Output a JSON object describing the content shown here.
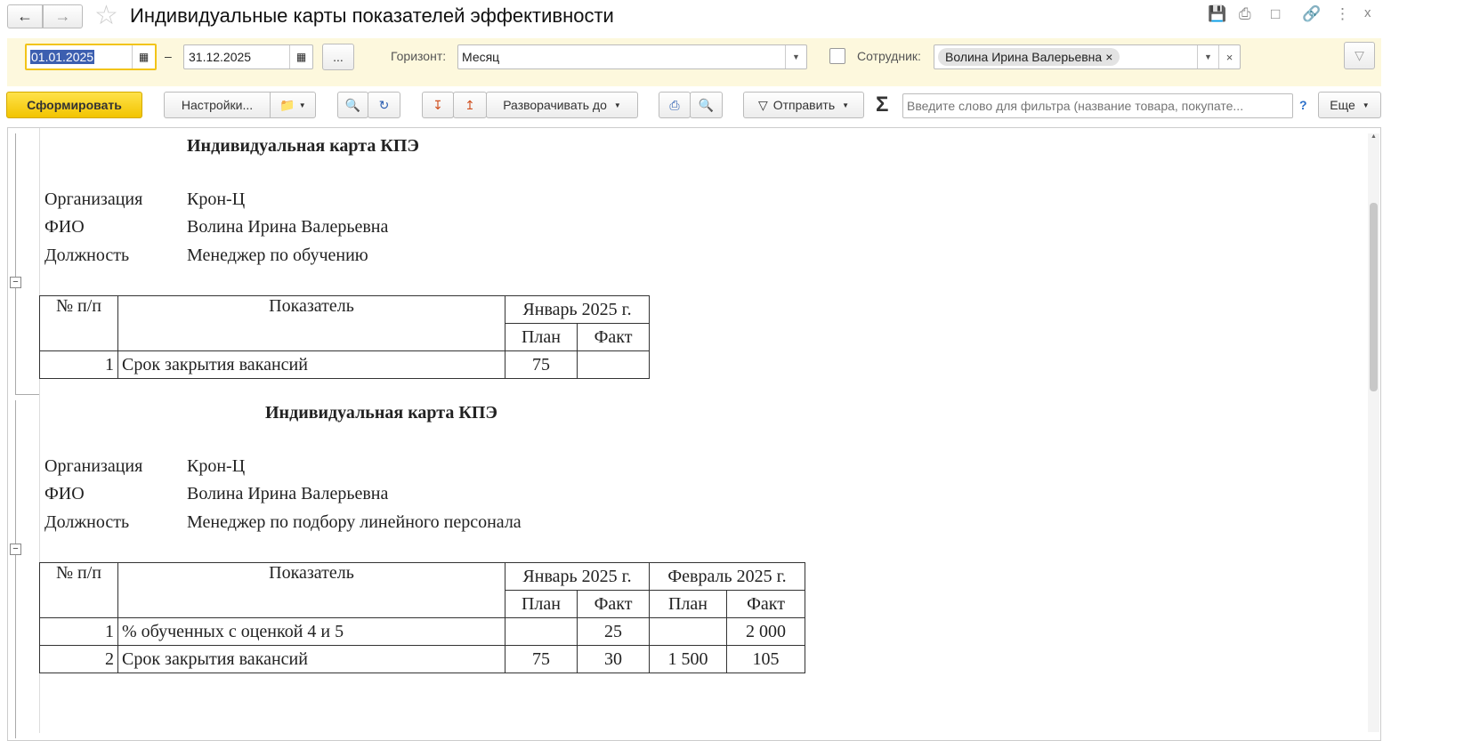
{
  "window": {
    "title": "Индивидуальные карты показателей эффективности"
  },
  "filters": {
    "date_from": "01.01.2025",
    "date_sep": "–",
    "date_to": "31.12.2025",
    "more": "...",
    "horizon_label": "Горизонт:",
    "horizon_value": "Месяц",
    "employee_label": "Сотрудник:",
    "employee_value": "Волина Ирина Валерьевна"
  },
  "toolbar": {
    "generate": "Сформировать",
    "settings": "Настройки...",
    "expand_to": "Разворачивать до",
    "send": "Отправить",
    "filter_placeholder": "Введите слово для фильтра (название товара, покупате...",
    "help": "?",
    "more": "Еще"
  },
  "cards": [
    {
      "title": "Индивидуальная карта КПЭ",
      "org_label": "Организация",
      "org": "Крон-Ц",
      "fio_label": "ФИО",
      "fio": "Волина Ирина Валерьевна",
      "pos_label": "Должность",
      "pos": "Менеджер по обучению",
      "headers": {
        "num": "№ п/п",
        "indicator": "Показатель",
        "months": [
          "Январь 2025 г."
        ],
        "plan": "План",
        "fact": "Факт"
      },
      "rows": [
        {
          "n": "1",
          "name": "Срок закрытия вакансий",
          "values": [
            "75",
            ""
          ]
        }
      ]
    },
    {
      "title": "Индивидуальная карта КПЭ",
      "org_label": "Организация",
      "org": "Крон-Ц",
      "fio_label": "ФИО",
      "fio": "Волина Ирина Валерьевна",
      "pos_label": "Должность",
      "pos": "Менеджер по подбору линейного персонала",
      "headers": {
        "num": "№ п/п",
        "indicator": "Показатель",
        "months": [
          "Январь 2025 г.",
          "Февраль 2025 г."
        ],
        "plan": "План",
        "fact": "Факт"
      },
      "rows": [
        {
          "n": "1",
          "name": "% обученных с оценкой 4 и 5",
          "values": [
            "",
            "25",
            "",
            "2 000"
          ]
        },
        {
          "n": "2",
          "name": "Срок закрытия вакансий",
          "values": [
            "75",
            "30",
            "1 500",
            "105"
          ]
        }
      ]
    }
  ]
}
